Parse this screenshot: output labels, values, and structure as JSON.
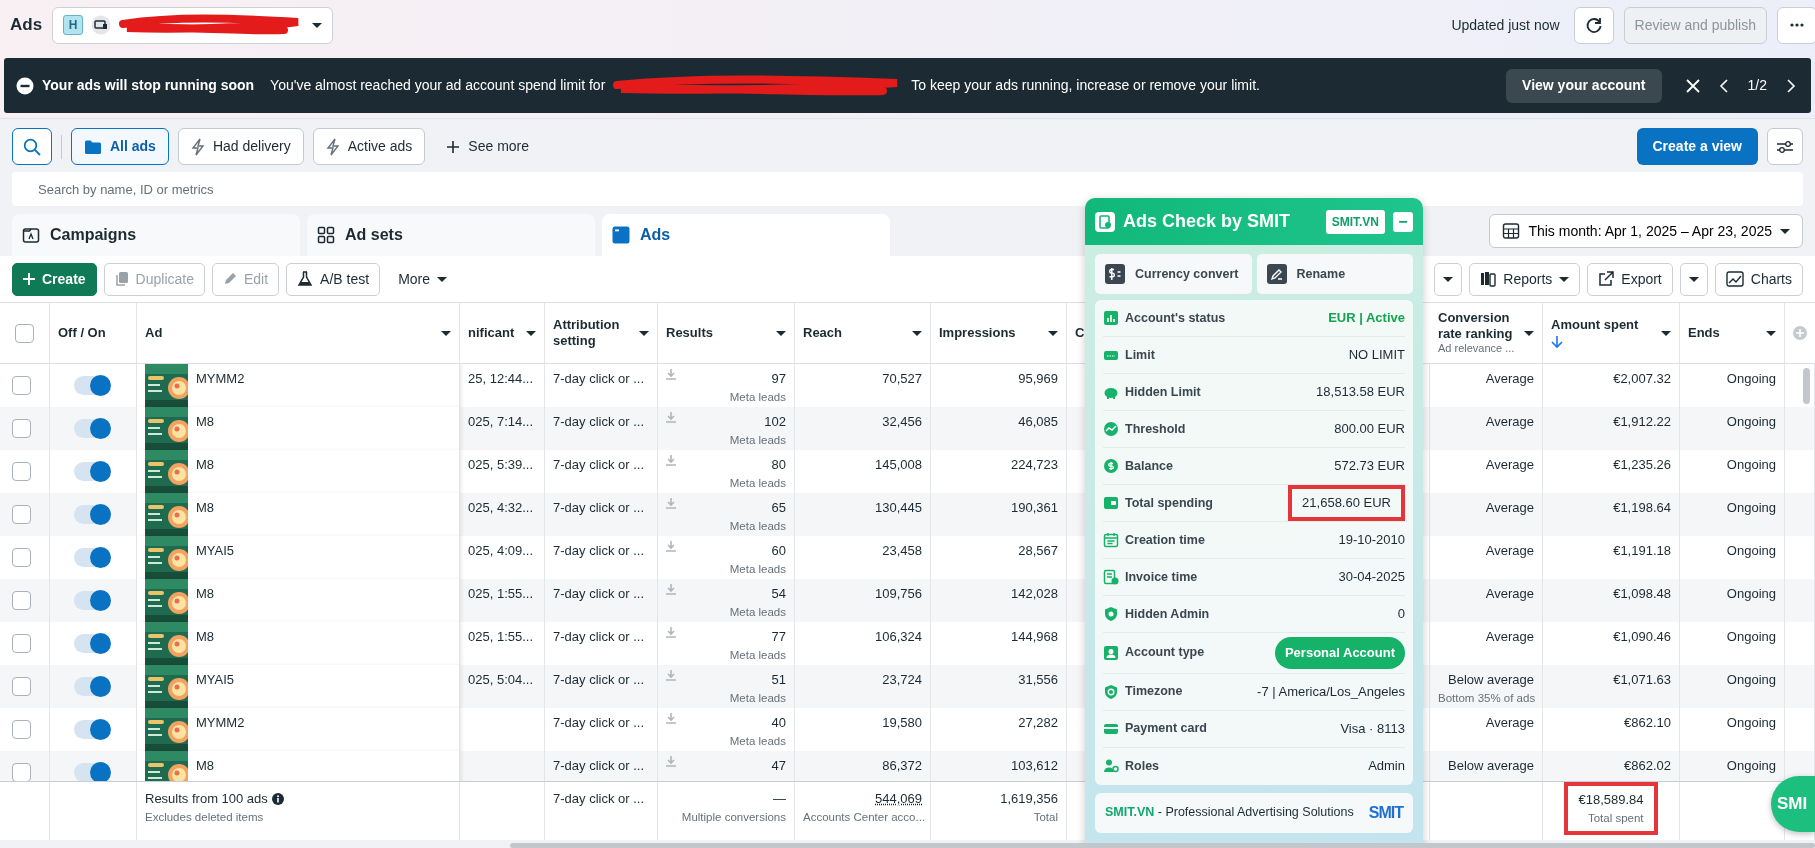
{
  "top_bar": {
    "title": "Ads",
    "account_selector": {
      "badge": "H",
      "redacted": true
    },
    "updated": "Updated just now",
    "review_button": {
      "label": "Review and publish",
      "disabled": true
    }
  },
  "banner": {
    "title": "Your ads will stop running soon",
    "text_before": "You've almost reached your ad account spend limit for",
    "redacted": true,
    "text_after": "To keep your ads running, increase or remove your limit.",
    "action": "View your account",
    "pager": "1/2"
  },
  "filters": {
    "chips": [
      {
        "label": "All ads",
        "selected": true
      },
      {
        "label": "Had delivery",
        "selected": false
      },
      {
        "label": "Active ads",
        "selected": false
      }
    ],
    "see_more": "See more",
    "create_view": "Create a view"
  },
  "search": {
    "placeholder": "Search by name, ID or metrics"
  },
  "tabs": [
    {
      "label": "Campaigns",
      "selected": false
    },
    {
      "label": "Ad sets",
      "selected": false
    },
    {
      "label": "Ads",
      "selected": true
    }
  ],
  "date_range": "This month: Apr 1, 2025 – Apr 23, 2025",
  "toolbar": {
    "left": [
      {
        "label": "Create",
        "kind": "primary"
      },
      {
        "label": "Duplicate",
        "kind": "disabled"
      },
      {
        "label": "Edit",
        "kind": "disabled"
      },
      {
        "label": "A/B test",
        "kind": "normal"
      },
      {
        "label": "More",
        "kind": "menu"
      }
    ],
    "right": [
      {
        "kind": "caret"
      },
      {
        "label": "Reports",
        "kind": "menu"
      },
      {
        "label": "Export",
        "kind": "normal"
      },
      {
        "kind": "caret"
      },
      {
        "label": "Charts",
        "kind": "normal"
      }
    ]
  },
  "table": {
    "header_checked": false,
    "columns": [
      {
        "label": "Off / On",
        "sorted": false
      },
      {
        "label": "Ad",
        "sorted": false
      },
      {
        "label": "nificant",
        "sorted": false
      },
      {
        "label": "Attribution setting",
        "sorted": false
      },
      {
        "label": "Results",
        "sorted": false
      },
      {
        "label": "Reach",
        "sorted": false
      },
      {
        "label": "Impressions",
        "sorted": false
      },
      {
        "label": "C",
        "sorted": false
      },
      {
        "label": "Conversion rate ranking",
        "sub": "Ad relevance ...",
        "sorted": false
      },
      {
        "label": "Amount spent",
        "sorted": true
      },
      {
        "label": "Ends",
        "sorted": false
      }
    ],
    "rows": [
      {
        "checked": false,
        "on": true,
        "ad": "MYMM2",
        "column_3": "25, 12:44...",
        "attribution": "7-day click or ...",
        "results": "97",
        "results_sub": "Meta leads",
        "reach": "70,527",
        "impressions": "95,969",
        "ranking": "Average",
        "amount": "€2,007.32",
        "ends": "Ongoing"
      },
      {
        "checked": false,
        "on": true,
        "ad": "M8",
        "column_3": "025, 7:14...",
        "attribution": "7-day click or ...",
        "results": "102",
        "results_sub": "Meta leads",
        "reach": "32,456",
        "impressions": "46,085",
        "ranking": "Average",
        "amount": "€1,912.22",
        "ends": "Ongoing"
      },
      {
        "checked": false,
        "on": true,
        "ad": "M8",
        "column_3": "025, 5:39...",
        "attribution": "7-day click or ...",
        "results": "80",
        "results_sub": "Meta leads",
        "reach": "145,008",
        "impressions": "224,723",
        "ranking": "Average",
        "amount": "€1,235.26",
        "ends": "Ongoing"
      },
      {
        "checked": false,
        "on": true,
        "ad": "M8",
        "column_3": "025, 4:32...",
        "attribution": "7-day click or ...",
        "results": "65",
        "results_sub": "Meta leads",
        "reach": "130,445",
        "impressions": "190,361",
        "ranking": "Average",
        "amount": "€1,198.64",
        "ends": "Ongoing"
      },
      {
        "checked": false,
        "on": true,
        "ad": "MYAI5",
        "column_3": "025, 4:09...",
        "attribution": "7-day click or ...",
        "results": "60",
        "results_sub": "Meta leads",
        "reach": "23,458",
        "impressions": "28,567",
        "ranking": "Average",
        "amount": "€1,191.18",
        "ends": "Ongoing"
      },
      {
        "checked": false,
        "on": true,
        "ad": "M8",
        "column_3": "025, 1:55...",
        "attribution": "7-day click or ...",
        "results": "54",
        "results_sub": "Meta leads",
        "reach": "109,756",
        "impressions": "142,028",
        "ranking": "Average",
        "amount": "€1,098.48",
        "ends": "Ongoing"
      },
      {
        "checked": false,
        "on": true,
        "ad": "M8",
        "column_3": "025, 1:55...",
        "attribution": "7-day click or ...",
        "results": "77",
        "results_sub": "Meta leads",
        "reach": "106,324",
        "impressions": "144,968",
        "ranking": "Average",
        "amount": "€1,090.46",
        "ends": "Ongoing"
      },
      {
        "checked": false,
        "on": true,
        "ad": "MYAI5",
        "column_3": "025, 5:04...",
        "attribution": "7-day click or ...",
        "results": "51",
        "results_sub": "Meta leads",
        "reach": "23,724",
        "impressions": "31,556",
        "ranking": "Below average",
        "ranking_sub": "Bottom 35% of ads",
        "amount": "€1,071.63",
        "ends": "Ongoing"
      },
      {
        "checked": false,
        "on": true,
        "ad": "MYMM2",
        "attribution": "7-day click or ...",
        "results": "40",
        "results_sub": "Meta leads",
        "reach": "19,580",
        "impressions": "27,282",
        "ranking": "Average",
        "amount": "€862.10",
        "ends": "Ongoing"
      },
      {
        "checked": false,
        "on": true,
        "ad": "M8",
        "attribution": "7-day click or ...",
        "results": "47",
        "reach": "86,372",
        "impressions": "103,612",
        "ranking": "Below average",
        "amount": "€862.02",
        "ends": "Ongoing"
      }
    ],
    "summary": {
      "label": "Results from 100 ads",
      "note": "Excludes deleted items",
      "attribution": "7-day click or ...",
      "results": "—",
      "results_sub": "Multiple conversions",
      "reach": "544,069",
      "reach_sub": "Accounts Center acco...",
      "impressions": "1,619,356",
      "impressions_sub": "Total",
      "amount": "€18,589.84",
      "amount_sub": "Total spent",
      "amount_highlighted": true
    }
  },
  "panel": {
    "title": "Ads Check by SMIT",
    "badge": "SMIT.VN",
    "minimize": "−",
    "actions": [
      "Currency convert",
      "Rename"
    ],
    "rows": [
      {
        "label": "Account's status",
        "value": "EUR | Active",
        "kind": "status",
        "highlighted": false
      },
      {
        "label": "Limit",
        "value": "NO LIMIT",
        "kind": "text",
        "highlighted": false
      },
      {
        "label": "Hidden Limit",
        "value": "18,513.58 EUR",
        "kind": "text",
        "highlighted": false
      },
      {
        "label": "Threshold",
        "value": "800.00 EUR",
        "kind": "text",
        "highlighted": false
      },
      {
        "label": "Balance",
        "value": "572.73 EUR",
        "kind": "text",
        "highlighted": false
      },
      {
        "label": "Total spending",
        "value": "21,658.60 EUR",
        "kind": "text",
        "highlighted": true
      },
      {
        "label": "Creation time",
        "value": "19-10-2010",
        "kind": "text",
        "highlighted": false
      },
      {
        "label": "Invoice time",
        "value": "30-04-2025",
        "kind": "text",
        "highlighted": false
      },
      {
        "label": "Hidden Admin",
        "value": "0",
        "kind": "text",
        "highlighted": false
      },
      {
        "label": "Account type",
        "value": "Personal Account",
        "kind": "pill",
        "highlighted": false
      },
      {
        "label": "Timezone",
        "value": "-7 | America/Los_Angeles",
        "kind": "text",
        "highlighted": false
      },
      {
        "label": "Payment card",
        "value": "Visa · 8113",
        "kind": "text",
        "highlighted": false
      },
      {
        "label": "Roles",
        "value": "Admin",
        "kind": "text",
        "highlighted": false
      }
    ],
    "footer_brand": "SMIT.VN",
    "footer_text": " - Professional Advertising Solutions",
    "logo": "SMIT"
  },
  "floating_badge": "SMI"
}
